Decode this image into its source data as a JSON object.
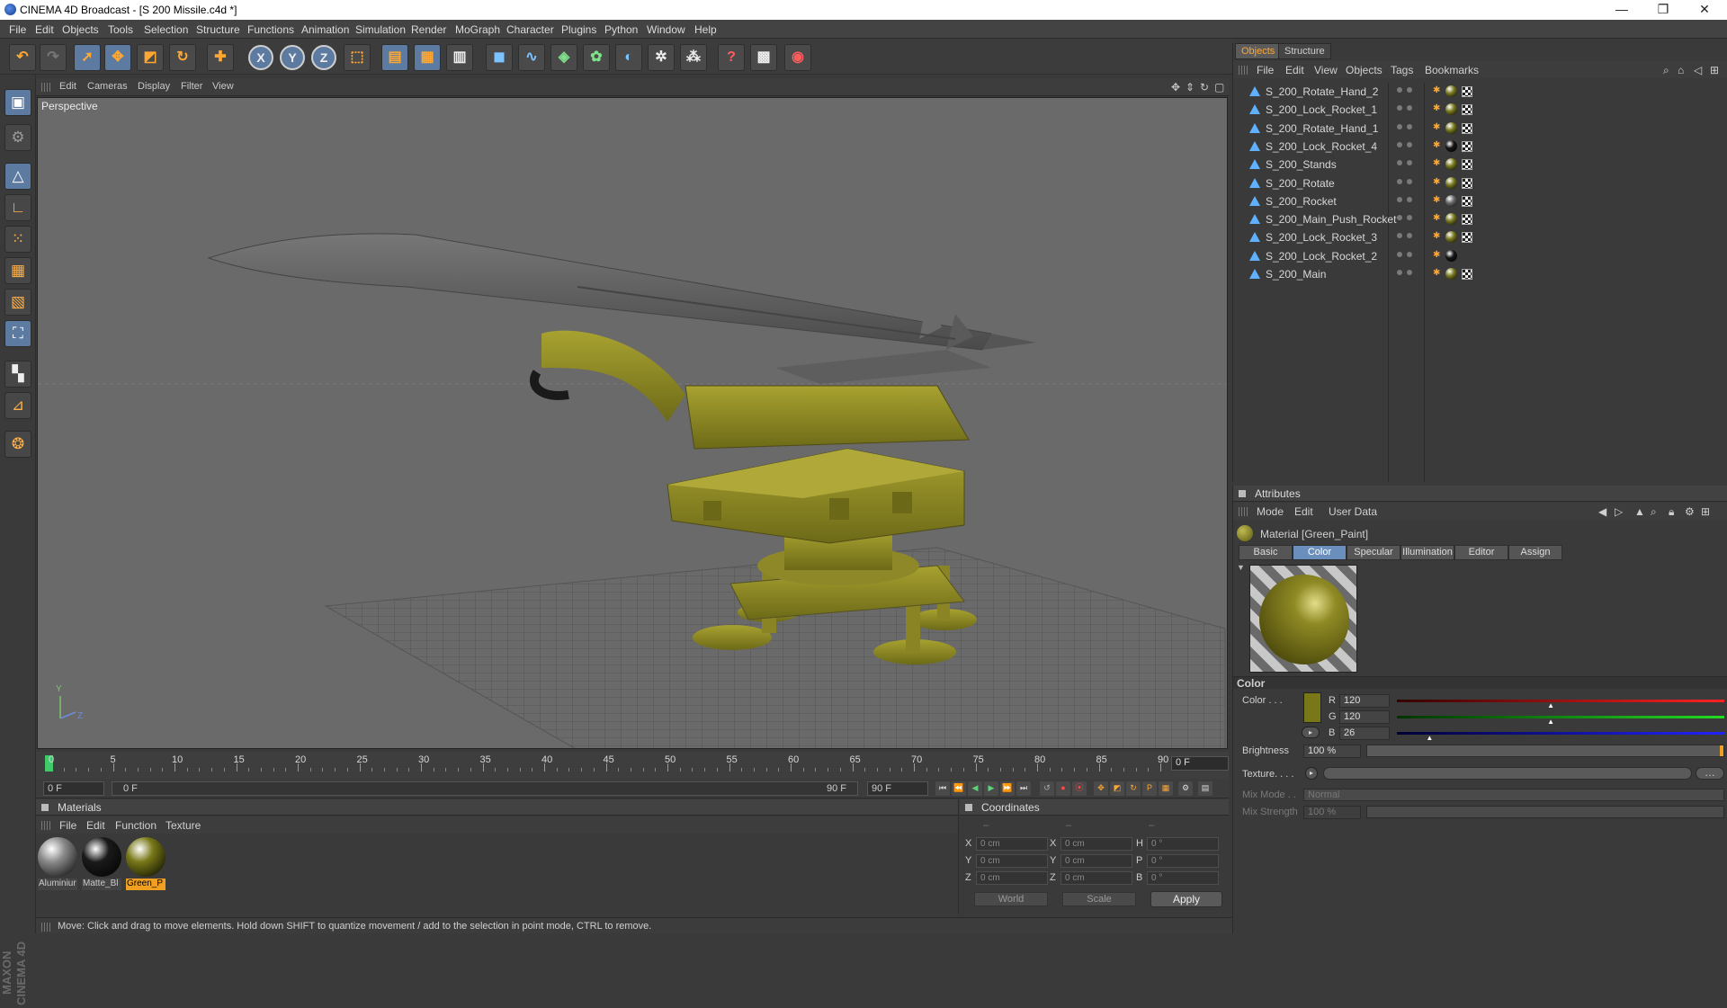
{
  "window": {
    "title": "CINEMA 4D Broadcast - [S 200 Missile.c4d *]",
    "controls": [
      "—",
      "❐",
      "✕"
    ]
  },
  "menubar": [
    "File",
    "Edit",
    "Objects",
    "Tools",
    "Selection",
    "Structure",
    "Functions",
    "Animation",
    "Simulation",
    "Render",
    "MoGraph",
    "Character",
    "Plugins",
    "Python",
    "Window",
    "Help"
  ],
  "toolbar": {
    "icons": [
      "undo-icon",
      "redo-icon",
      "live-selection-icon",
      "move-icon",
      "scale-icon",
      "rotate-icon",
      "create-icon",
      "x-axis-icon",
      "y-axis-icon",
      "z-axis-icon",
      "coordinate-system-icon",
      "render-view-icon",
      "render-picture-viewer-icon",
      "edit-render-settings-icon",
      "cube-icon",
      "spline-icon",
      "nurbs-icon",
      "array-icon",
      "deformer-icon",
      "scene-icon",
      "emitter-icon",
      "help-icon",
      "camera-icon",
      "light-icon"
    ],
    "axis_labels": [
      "X",
      "Y",
      "Z"
    ]
  },
  "viewport": {
    "menu": [
      "Edit",
      "Cameras",
      "Display",
      "Filter",
      "View"
    ],
    "label": "Perspective",
    "axis": {
      "y": "Y",
      "z": "Z"
    }
  },
  "timeline": {
    "ticks": [
      "0",
      "5",
      "10",
      "15",
      "20",
      "25",
      "30",
      "35",
      "40",
      "45",
      "50",
      "55",
      "60",
      "65",
      "70",
      "75",
      "80",
      "85",
      "90"
    ],
    "current_frame": "0 F",
    "start": "0 F",
    "range_start": "0 F",
    "range_end": "90 F",
    "end": "90 F"
  },
  "materials": {
    "title": "Materials",
    "menu": [
      "File",
      "Edit",
      "Function",
      "Texture"
    ],
    "items": [
      {
        "label": "Aluminiur",
        "color": "#8a8a8a",
        "selected": false
      },
      {
        "label": "Matte_Bl",
        "color": "#1a1a1a",
        "selected": false
      },
      {
        "label": "Green_P",
        "color": "#787818",
        "selected": true
      }
    ]
  },
  "coordinates": {
    "title": "Coordinates",
    "headers": [
      "–",
      "–",
      "–"
    ],
    "rows": [
      {
        "a": "X",
        "av": "0 cm",
        "b": "X",
        "bv": "0 cm",
        "c": "H",
        "cv": "0 °"
      },
      {
        "a": "Y",
        "av": "0 cm",
        "b": "Y",
        "bv": "0 cm",
        "c": "P",
        "cv": "0 °"
      },
      {
        "a": "Z",
        "av": "0 cm",
        "b": "Z",
        "bv": "0 cm",
        "c": "B",
        "cv": "0 °"
      }
    ],
    "mode1": "World",
    "mode2": "Scale",
    "apply": "Apply"
  },
  "status": "Move: Click and drag to move elements. Hold down SHIFT to quantize movement / add to the selection in point mode, CTRL to remove.",
  "objects_panel": {
    "tabs": [
      "Objects",
      "Structure"
    ],
    "menu": [
      "File",
      "Edit",
      "View",
      "Objects",
      "Tags",
      "Bookmarks"
    ],
    "items": [
      {
        "name": "S_200_Rotate_Hand_2",
        "ball": "#7a7a20"
      },
      {
        "name": "S_200_Lock_Rocket_1",
        "ball": "#7a7a20"
      },
      {
        "name": "S_200_Rotate_Hand_1",
        "ball": "#7a7a20"
      },
      {
        "name": "S_200_Lock_Rocket_4",
        "ball": "#151515"
      },
      {
        "name": "S_200_Stands",
        "ball": "#7a7a20"
      },
      {
        "name": "S_200_Rotate",
        "ball": "#7a7a20"
      },
      {
        "name": "S_200_Rocket",
        "ball": "#6a6a6a"
      },
      {
        "name": "S_200_Main_Push_Rocket",
        "ball": "#7a7a20"
      },
      {
        "name": "S_200_Lock_Rocket_3",
        "ball": "#7a7a20"
      },
      {
        "name": "S_200_Lock_Rocket_2",
        "ball": "#151515"
      },
      {
        "name": "S_200_Main",
        "ball": "#7a7a20"
      }
    ]
  },
  "attributes": {
    "title": "Attributes",
    "menu": [
      "Mode",
      "Edit",
      "User Data"
    ],
    "material_name": "Material [Green_Paint]",
    "tabs": [
      "Basic",
      "Color",
      "Specular",
      "Illumination",
      "Editor",
      "Assign"
    ],
    "active_tab": "Color",
    "section": "Color",
    "color_label": "Color . . .",
    "swatch": "#787818",
    "r_label": "R",
    "r": "120",
    "g_label": "G",
    "g": "120",
    "b_label": "B",
    "b": "26",
    "r_level": 0.47,
    "g_level": 0.47,
    "b_level": 0.1,
    "brightness_label": "Brightness",
    "brightness": "100 %",
    "texture_label": "Texture. . . .",
    "mixmode_label": "Mix Mode . .",
    "mixmode": "Normal",
    "mixstrength_label": "Mix Strength",
    "mixstrength": "100 %"
  }
}
